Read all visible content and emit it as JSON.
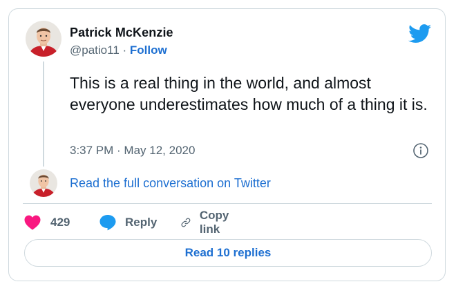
{
  "author": {
    "name": "Patrick McKenzie",
    "handle": "@patio11",
    "separator": " · ",
    "follow_label": "Follow"
  },
  "tweet": {
    "text": "This is a real thing in the world, and almost everyone underestimates how much of a thing it is.",
    "timestamp": "3:37 PM · May 12, 2020"
  },
  "thread": {
    "full_conversation_label": "Read the full conversation on Twitter"
  },
  "actions": {
    "like_count": "429",
    "reply_label": "Reply",
    "copy_link_label": "Copy link"
  },
  "read_replies_label": "Read 10 replies",
  "colors": {
    "twitter_blue": "#1d9bf0",
    "link_blue": "#1d6fd1",
    "like_pink": "#f91880",
    "muted": "#536471",
    "border": "#cfd9de"
  },
  "icons": [
    "twitter-bird-icon",
    "info-icon",
    "heart-icon",
    "reply-bubble-icon",
    "link-icon"
  ]
}
